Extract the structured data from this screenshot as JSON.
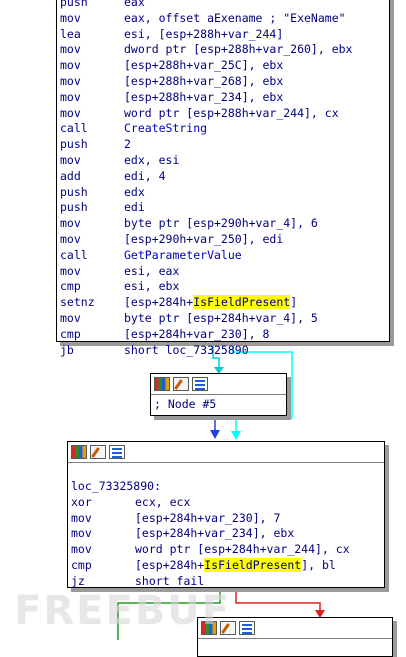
{
  "node1": {
    "lines": [
      {
        "m": "push",
        "o": "eax"
      },
      {
        "m": "mov",
        "o": "eax, offset aExename ; \"ExeName\""
      },
      {
        "m": "lea",
        "o": "esi, [esp+288h+var_244]"
      },
      {
        "m": "mov",
        "o": "dword ptr [esp+288h+var_260], ebx"
      },
      {
        "m": "mov",
        "o": "[esp+288h+var_25C], ebx"
      },
      {
        "m": "mov",
        "o": "[esp+288h+var_268], ebx"
      },
      {
        "m": "mov",
        "o": "[esp+288h+var_234], ebx"
      },
      {
        "m": "mov",
        "o": "word ptr [esp+288h+var_244], cx"
      },
      {
        "m": "call",
        "o": "CreateString"
      },
      {
        "m": "push",
        "o": "2"
      },
      {
        "m": "mov",
        "o": "edx, esi"
      },
      {
        "m": "add",
        "o": "edi, 4"
      },
      {
        "m": "push",
        "o": "edx"
      },
      {
        "m": "push",
        "o": "edi"
      },
      {
        "m": "mov",
        "o": "byte ptr [esp+290h+var_4], 6"
      },
      {
        "m": "mov",
        "o": "[esp+290h+var_250], edi"
      },
      {
        "m": "call",
        "o": "GetParameterValue"
      },
      {
        "m": "mov",
        "o": "esi, eax"
      },
      {
        "m": "cmp",
        "o": "esi, ebx"
      },
      {
        "m": "setnz",
        "o1": "[esp+284h+",
        "hl": "IsFieldPresent",
        "o2": "]"
      },
      {
        "m": "mov",
        "o": "byte ptr [esp+284h+var_4], 5"
      },
      {
        "m": "cmp",
        "o": "[esp+284h+var_230], 8"
      },
      {
        "m": "jb",
        "o": "short loc_73325890"
      }
    ]
  },
  "node5": {
    "label": "; Node #5"
  },
  "node3": {
    "label": "loc_73325890:",
    "lines": [
      {
        "m": "xor",
        "o": "ecx, ecx"
      },
      {
        "m": "mov",
        "o": "[esp+284h+var_230], 7"
      },
      {
        "m": "mov",
        "o": "[esp+284h+var_234], ebx"
      },
      {
        "m": "mov",
        "o": "word ptr [esp+284h+var_244], cx"
      },
      {
        "m": "cmp",
        "o1": "[esp+284h+",
        "hl": "IsFieldPresent",
        "o2": "], bl"
      },
      {
        "m": "jz",
        "o": "short fail"
      }
    ]
  },
  "watermark": "FREEBUF"
}
